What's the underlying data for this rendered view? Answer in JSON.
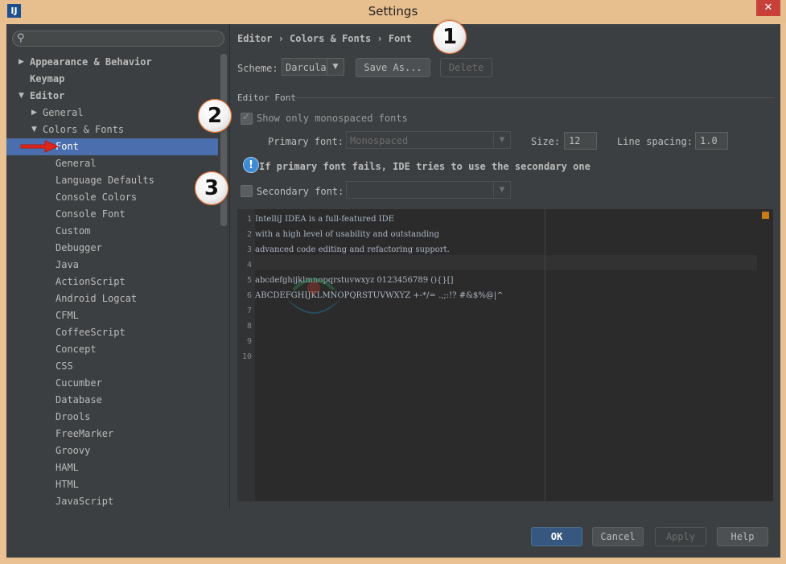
{
  "window": {
    "title": "Settings",
    "app_icon": "IJ",
    "close_glyph": "✕"
  },
  "sidebar": {
    "search_placeholder": "",
    "items": [
      {
        "label": "Appearance & Behavior",
        "level": 0,
        "arrow": "▶",
        "bold": true
      },
      {
        "label": "Keymap",
        "level": 0,
        "arrow": "",
        "bold": true
      },
      {
        "label": "Editor",
        "level": 0,
        "arrow": "▼",
        "bold": true
      },
      {
        "label": "General",
        "level": 1,
        "arrow": "▶"
      },
      {
        "label": "Colors & Fonts",
        "level": 1,
        "arrow": "▼"
      },
      {
        "label": "Font",
        "level": 2,
        "arrow": "",
        "selected": true
      },
      {
        "label": "General",
        "level": 2,
        "arrow": ""
      },
      {
        "label": "Language Defaults",
        "level": 2,
        "arrow": ""
      },
      {
        "label": "Console Colors",
        "level": 2,
        "arrow": ""
      },
      {
        "label": "Console Font",
        "level": 2,
        "arrow": ""
      },
      {
        "label": "Custom",
        "level": 2,
        "arrow": ""
      },
      {
        "label": "Debugger",
        "level": 2,
        "arrow": ""
      },
      {
        "label": "Java",
        "level": 2,
        "arrow": ""
      },
      {
        "label": "ActionScript",
        "level": 2,
        "arrow": ""
      },
      {
        "label": "Android Logcat",
        "level": 2,
        "arrow": ""
      },
      {
        "label": "CFML",
        "level": 2,
        "arrow": ""
      },
      {
        "label": "CoffeeScript",
        "level": 2,
        "arrow": ""
      },
      {
        "label": "Concept",
        "level": 2,
        "arrow": ""
      },
      {
        "label": "CSS",
        "level": 2,
        "arrow": ""
      },
      {
        "label": "Cucumber",
        "level": 2,
        "arrow": ""
      },
      {
        "label": "Database",
        "level": 2,
        "arrow": ""
      },
      {
        "label": "Drools",
        "level": 2,
        "arrow": ""
      },
      {
        "label": "FreeMarker",
        "level": 2,
        "arrow": ""
      },
      {
        "label": "Groovy",
        "level": 2,
        "arrow": ""
      },
      {
        "label": "HAML",
        "level": 2,
        "arrow": ""
      },
      {
        "label": "HTML",
        "level": 2,
        "arrow": ""
      },
      {
        "label": "JavaScript",
        "level": 2,
        "arrow": ""
      }
    ]
  },
  "main": {
    "breadcrumb": "Editor › Colors & Fonts › Font",
    "scheme_label": "Scheme:",
    "scheme_value": "Darcula",
    "save_as": "Save As...",
    "delete": "Delete",
    "section_title": "Editor Font",
    "show_mono": "Show only monospaced fonts",
    "primary_label": "Primary font:",
    "primary_value": "Monospaced",
    "size_label": "Size:",
    "size_value": "12",
    "spacing_label": "Line spacing:",
    "spacing_value": "1.0",
    "info_text": "If primary font fails, IDE tries to use the secondary one",
    "secondary_label": "Secondary font:",
    "secondary_value": ""
  },
  "badges": [
    "1",
    "2",
    "3"
  ],
  "editor": {
    "lines": [
      {
        "n": "1",
        "text": "IntelliJ IDEA is a full-featured IDE"
      },
      {
        "n": "2",
        "text": "with a high level of usability and outstanding"
      },
      {
        "n": "3",
        "text": "advanced code editing and refactoring support."
      },
      {
        "n": "4",
        "text": ""
      },
      {
        "n": "5",
        "text": "abcdefghijklmnopqrstuvwxyz 0123456789 (){}[]"
      },
      {
        "n": "6",
        "text": "ABCDEFGHIJKLMNOPQRSTUVWXYZ +-*/= .,;:!? #&$%@|^"
      },
      {
        "n": "7",
        "text": ""
      },
      {
        "n": "8",
        "text": ""
      },
      {
        "n": "9",
        "text": ""
      },
      {
        "n": "10",
        "text": ""
      }
    ]
  },
  "footer": {
    "ok": "OK",
    "cancel": "Cancel",
    "apply": "Apply",
    "help": "Help"
  },
  "colors": {
    "selection": "#4b6eaf",
    "panel": "#3c3f41",
    "editor_bg": "#2b2b2b",
    "badge_ring": "#e8641e",
    "arrow_red": "#e0251b"
  }
}
